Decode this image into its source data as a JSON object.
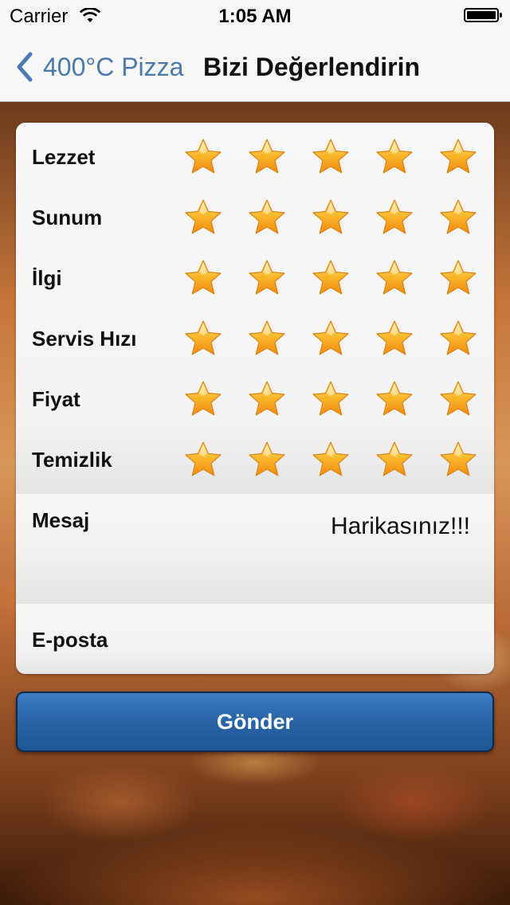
{
  "status_bar": {
    "carrier": "Carrier",
    "time": "1:05 AM"
  },
  "nav": {
    "back_label": "400°C Pizza",
    "title": "Bizi Değerlendirin",
    "accent_color": "#4b7ab0"
  },
  "ratings": [
    {
      "label": "Lezzet",
      "stars": 5
    },
    {
      "label": "Sunum",
      "stars": 5
    },
    {
      "label": "İlgi",
      "stars": 5
    },
    {
      "label": "Servis Hızı",
      "stars": 5
    },
    {
      "label": "Fiyat",
      "stars": 5
    },
    {
      "label": "Temizlik",
      "stars": 5
    }
  ],
  "message": {
    "label": "Mesaj",
    "value": "Harikasınız!!!"
  },
  "email": {
    "label": "E-posta",
    "value": "",
    "placeholder": ""
  },
  "submit_label": "Gönder",
  "colors": {
    "star_fill": "#f7a21b",
    "button": "#2a66a8"
  }
}
